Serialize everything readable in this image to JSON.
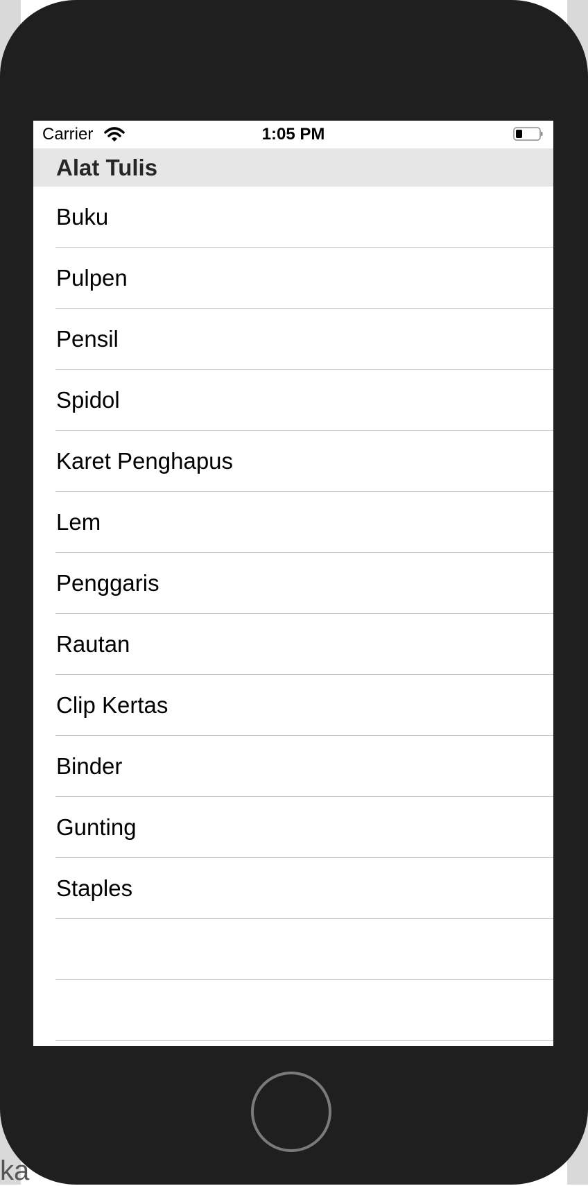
{
  "status_bar": {
    "carrier": "Carrier",
    "time": "1:05 PM"
  },
  "section": {
    "title": "Alat Tulis"
  },
  "items": [
    {
      "label": "Buku"
    },
    {
      "label": "Pulpen"
    },
    {
      "label": "Pensil"
    },
    {
      "label": "Spidol"
    },
    {
      "label": "Karet Penghapus"
    },
    {
      "label": "Lem"
    },
    {
      "label": "Penggaris"
    },
    {
      "label": "Rautan"
    },
    {
      "label": "Clip Kertas"
    },
    {
      "label": "Binder"
    },
    {
      "label": "Gunting"
    },
    {
      "label": "Staples"
    },
    {
      "label": ""
    },
    {
      "label": ""
    }
  ],
  "background": {
    "caption": "ka"
  },
  "colors": {
    "device": "#1f1f1f",
    "section_header": "#e6e6e6",
    "separator": "#c8c8c8"
  }
}
